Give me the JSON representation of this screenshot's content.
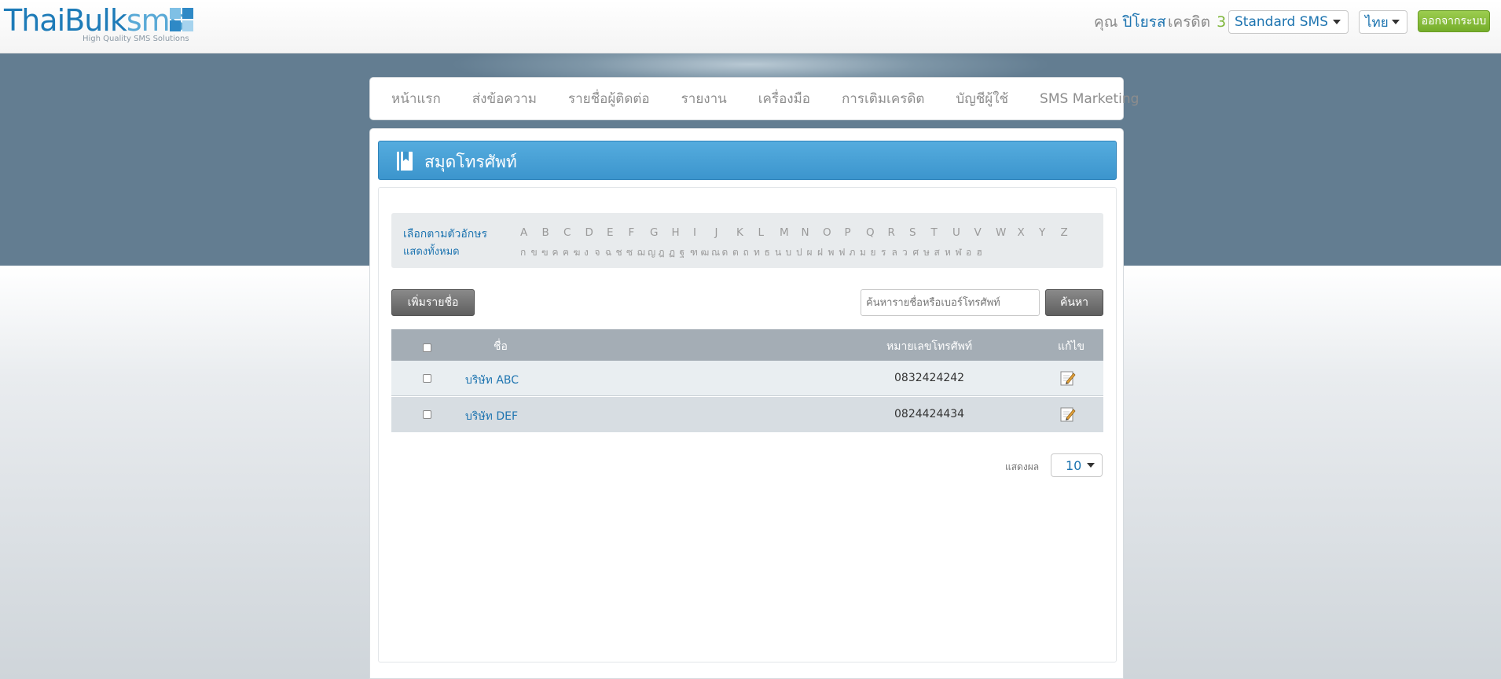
{
  "header": {
    "logo_main": "ThaiBulk",
    "logo_accent": "sms",
    "logo_tagline": "High Quality SMS Solutions",
    "user_prefix": "คุณ",
    "user_name": "ปิโยรส",
    "credit_label": "เครดิต",
    "credit_value": "3",
    "sms_type": "Standard SMS",
    "language": "ไทย",
    "logout_label": "ออกจากระบบ"
  },
  "nav": {
    "items": [
      "หน้าแรก",
      "ส่งข้อความ",
      "รายชื่อผู้ติดต่อ",
      "รายงาน",
      "เครื่องมือ",
      "การเติมเครดิต",
      "บัญชีผู้ใช้",
      "SMS Marketing"
    ]
  },
  "page": {
    "title": "สมุดโทรศัพท์"
  },
  "filter": {
    "label": "เลือกตามตัวอักษร",
    "show_all": "แสดงทั้งหมด",
    "letters_en": [
      "A",
      "B",
      "C",
      "D",
      "E",
      "F",
      "G",
      "H",
      "I",
      "J",
      "K",
      "L",
      "M",
      "N",
      "O",
      "P",
      "Q",
      "R",
      "S",
      "T",
      "U",
      "V",
      "W",
      "X",
      "Y",
      "Z"
    ],
    "letters_th": [
      "ก",
      "ข",
      "ฃ",
      "ค",
      "ฅ",
      "ฆ",
      "ง",
      "จ",
      "ฉ",
      "ช",
      "ซ",
      "ฌ",
      "ญ",
      "ฎ",
      "ฏ",
      "ฐ",
      "ฑ",
      "ฒ",
      "ณ",
      "ด",
      "ต",
      "ถ",
      "ท",
      "ธ",
      "น",
      "บ",
      "ป",
      "ผ",
      "ฝ",
      "พ",
      "ฟ",
      "ภ",
      "ม",
      "ย",
      "ร",
      "ล",
      "ว",
      "ศ",
      "ษ",
      "ส",
      "ห",
      "ฬ",
      "อ",
      "ฮ"
    ]
  },
  "actions": {
    "add_label": "เพิ่มรายชื่อ",
    "search_placeholder": "ค้นหารายชื่อหรือเบอร์โทรศัพท์",
    "search_label": "ค้นหา"
  },
  "table": {
    "columns": {
      "name": "ชื่อ",
      "phone": "หมายเลขโทรศัพท์",
      "edit": "แก้ไข"
    },
    "rows": [
      {
        "name": "บริษัท ABC",
        "phone": "0832424242"
      },
      {
        "name": "บริษัท DEF",
        "phone": "0824424434"
      }
    ]
  },
  "pagination": {
    "label": "แสดงผล",
    "page_size": "10"
  }
}
